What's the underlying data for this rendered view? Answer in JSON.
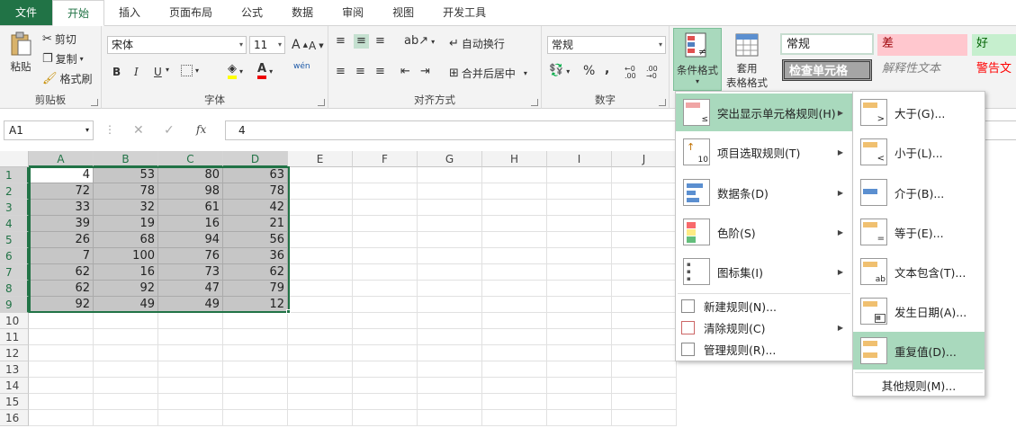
{
  "tabs": [
    "文件",
    "开始",
    "插入",
    "页面布局",
    "公式",
    "数据",
    "审阅",
    "视图",
    "开发工具"
  ],
  "clipboard": {
    "paste": "粘贴",
    "cut": "剪切",
    "copy": "复制",
    "format_painter": "格式刷",
    "label": "剪贴板"
  },
  "font": {
    "name": "宋体",
    "size": "11",
    "label": "字体",
    "bold": "B",
    "italic": "I",
    "underline": "U",
    "grow": "A",
    "shrink": "A",
    "wen": "wén"
  },
  "alignment": {
    "wrap": "自动换行",
    "merge": "合并后居中",
    "label": "对齐方式"
  },
  "number": {
    "format": "常规",
    "label": "数字",
    "percent": "%",
    "comma": ",",
    "inc": "←0 .00",
    "dec": ".00 →0"
  },
  "styles": {
    "cf": "条件格式",
    "table_fmt_1": "套用",
    "table_fmt_2": "表格格式",
    "normal": "常规",
    "bad": "差",
    "good": "好",
    "check": "检查单元格",
    "explain": "解释性文本",
    "warn": "警告文"
  },
  "formula_bar": {
    "name_box": "A1",
    "fx": "fx",
    "value": "4"
  },
  "columns": [
    "A",
    "B",
    "C",
    "D",
    "E",
    "F",
    "G",
    "H",
    "I",
    "J"
  ],
  "rows": [
    "1",
    "2",
    "3",
    "4",
    "5",
    "6",
    "7",
    "8",
    "9",
    "10",
    "11",
    "12",
    "13",
    "14",
    "15",
    "16"
  ],
  "cells": [
    [
      "4",
      "53",
      "80",
      "63"
    ],
    [
      "72",
      "78",
      "98",
      "78"
    ],
    [
      "33",
      "32",
      "61",
      "42"
    ],
    [
      "39",
      "19",
      "16",
      "21"
    ],
    [
      "26",
      "68",
      "94",
      "56"
    ],
    [
      "7",
      "100",
      "76",
      "36"
    ],
    [
      "62",
      "16",
      "73",
      "62"
    ],
    [
      "62",
      "92",
      "47",
      "79"
    ],
    [
      "92",
      "49",
      "49",
      "12"
    ]
  ],
  "cf_menu": {
    "highlight": "突出显示单元格规则(H)",
    "topbottom": "项目选取规则(T)",
    "databar": "数据条(D)",
    "colorscale": "色阶(S)",
    "iconset": "图标集(I)",
    "new_rule": "新建规则(N)...",
    "clear_rule": "清除规则(C)",
    "manage_rule": "管理规则(R)..."
  },
  "sub_menu": {
    "greater": "大于(G)...",
    "less": "小于(L)...",
    "between": "介于(B)...",
    "equal": "等于(E)...",
    "text": "文本包含(T)...",
    "date": "发生日期(A)...",
    "duplicate": "重复值(D)...",
    "more": "其他规则(M)..."
  },
  "colors": {
    "accent": "#217346",
    "hover": "#a9d9bd",
    "bad_bg": "#ffc7ce",
    "good_bg": "#c6efce",
    "check_bg": "#a5a5a5"
  }
}
